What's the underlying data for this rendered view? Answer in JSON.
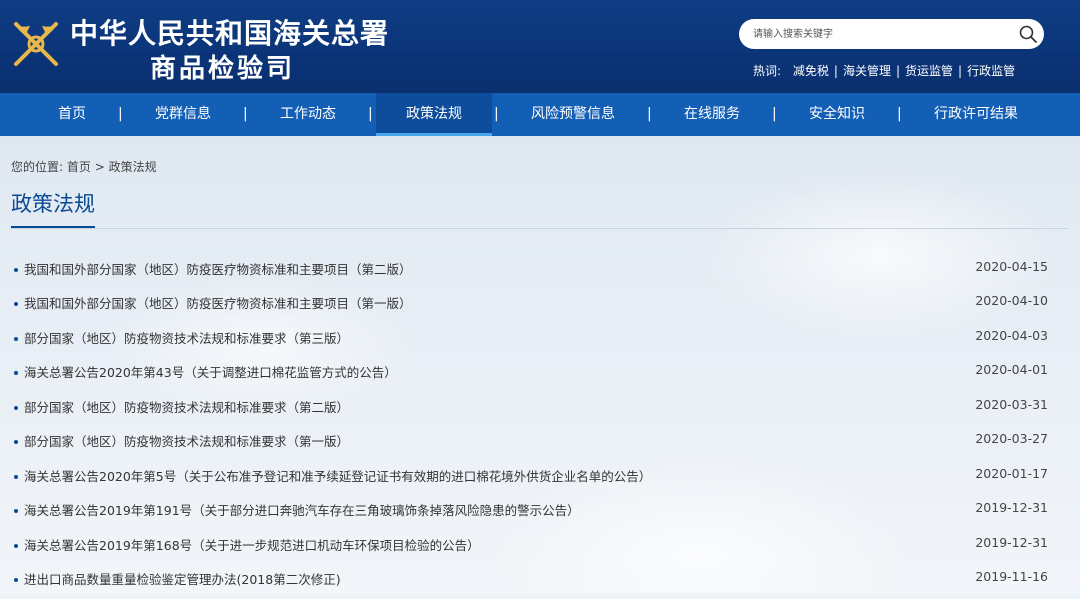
{
  "header": {
    "title_line1": "中华人民共和国海关总署",
    "title_line2": "商品检验司",
    "search_placeholder": "请输入搜索关键字",
    "hot_label": "热词:",
    "hot_words": [
      "减免税",
      "海关管理",
      "货运监管",
      "行政监管"
    ],
    "hot_separator": "|"
  },
  "nav": {
    "separator": "|",
    "items": [
      {
        "label": "首页"
      },
      {
        "label": "党群信息"
      },
      {
        "label": "工作动态"
      },
      {
        "label": "政策法规"
      },
      {
        "label": "风险预警信息"
      },
      {
        "label": "在线服务"
      },
      {
        "label": "安全知识"
      },
      {
        "label": "行政许可结果"
      }
    ],
    "active_index": 3
  },
  "breadcrumb": {
    "prefix": "您的位置:",
    "home": "首页",
    "separator": ">",
    "current": "政策法规"
  },
  "page_title": "政策法规",
  "articles": [
    {
      "title": "我国和国外部分国家（地区）防疫医疗物资标准和主要项目（第二版）",
      "date": "2020-04-15"
    },
    {
      "title": "我国和国外部分国家（地区）防疫医疗物资标准和主要项目（第一版）",
      "date": "2020-04-10"
    },
    {
      "title": "部分国家（地区）防疫物资技术法规和标准要求（第三版）",
      "date": "2020-04-03"
    },
    {
      "title": "海关总署公告2020年第43号（关于调整进口棉花监管方式的公告）",
      "date": "2020-04-01"
    },
    {
      "title": "部分国家（地区）防疫物资技术法规和标准要求（第二版）",
      "date": "2020-03-31"
    },
    {
      "title": "部分国家（地区）防疫物资技术法规和标准要求（第一版）",
      "date": "2020-03-27"
    },
    {
      "title": "海关总署公告2020年第5号（关于公布准予登记和准予续延登记证书有效期的进口棉花境外供货企业名单的公告）",
      "date": "2020-01-17"
    },
    {
      "title": "海关总署公告2019年第191号（关于部分进口奔驰汽车存在三角玻璃饰条掉落风险隐患的警示公告）",
      "date": "2019-12-31"
    },
    {
      "title": "海关总署公告2019年第168号（关于进一步规范进口机动车环保项目检验的公告）",
      "date": "2019-12-31"
    },
    {
      "title": "进出口商品数量重量检验鉴定管理办法(2018第二次修正)",
      "date": "2019-11-16"
    }
  ],
  "colors": {
    "header_bg": "#0f3d85",
    "nav_bg": "#135fb5",
    "nav_active_bg": "#0e4d9c",
    "nav_active_underline": "#4aa6ef",
    "title_blue": "#0b4a95",
    "logo_gold": "#e8b84a"
  },
  "icons": {
    "logo": "customs-emblem-icon",
    "search": "search-icon",
    "bullet": "bullet-dot-icon"
  }
}
